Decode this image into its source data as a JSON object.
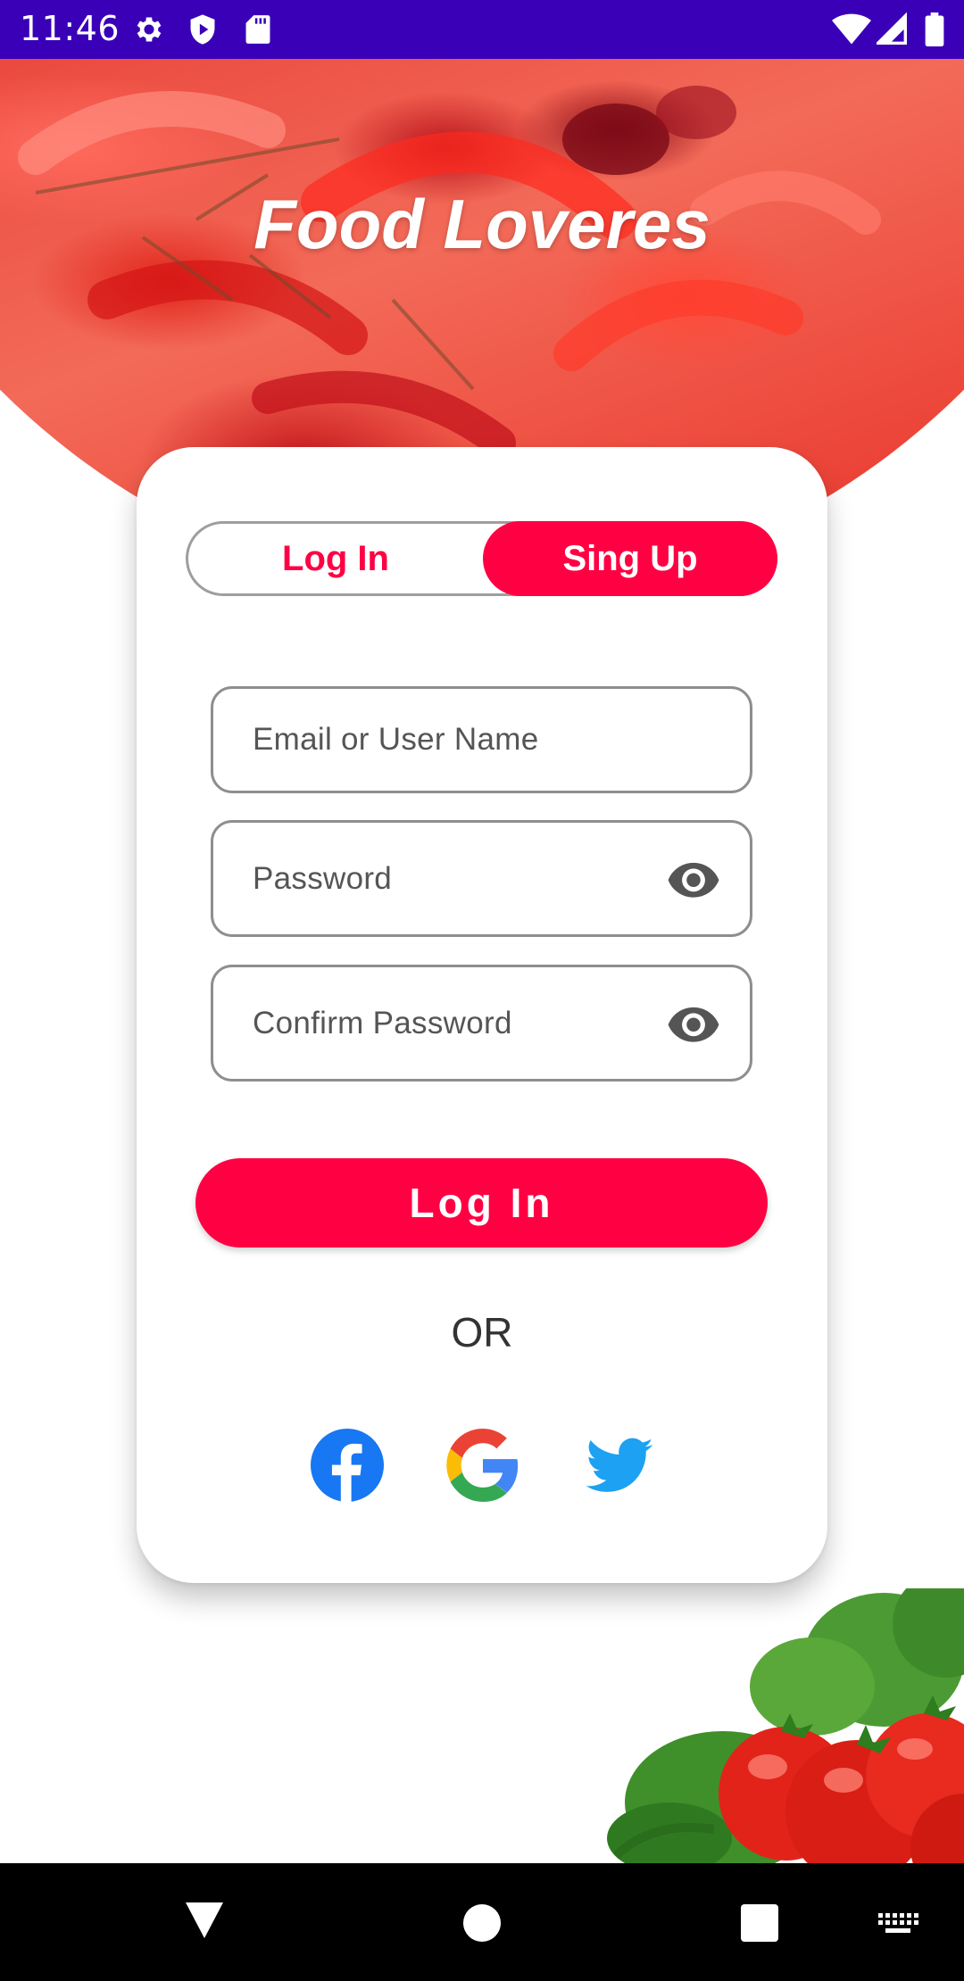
{
  "status_bar": {
    "time": "11:46",
    "icons": [
      "gear-icon",
      "shield-icon",
      "sd-card-icon"
    ],
    "right_icons": [
      "wifi-icon",
      "signal-icon",
      "battery-icon"
    ],
    "color": "#3a00b8"
  },
  "hero": {
    "title": "Food Loveres"
  },
  "auth_toggle": {
    "login_label": "Log In",
    "signup_label": "Sing Up",
    "active": "Sing Up"
  },
  "form": {
    "email_placeholder": "Email or User Name",
    "password_placeholder": "Password",
    "confirm_placeholder": "Confirm Password"
  },
  "submit_label": "Log In",
  "divider_text": "OR",
  "social": [
    "facebook-icon",
    "google-icon",
    "twitter-icon"
  ],
  "colors": {
    "accent": "#ff0043",
    "status_bar": "#3a00b8"
  },
  "nav_bar": [
    "back-icon",
    "home-icon",
    "recents-icon",
    "keyboard-icon"
  ]
}
